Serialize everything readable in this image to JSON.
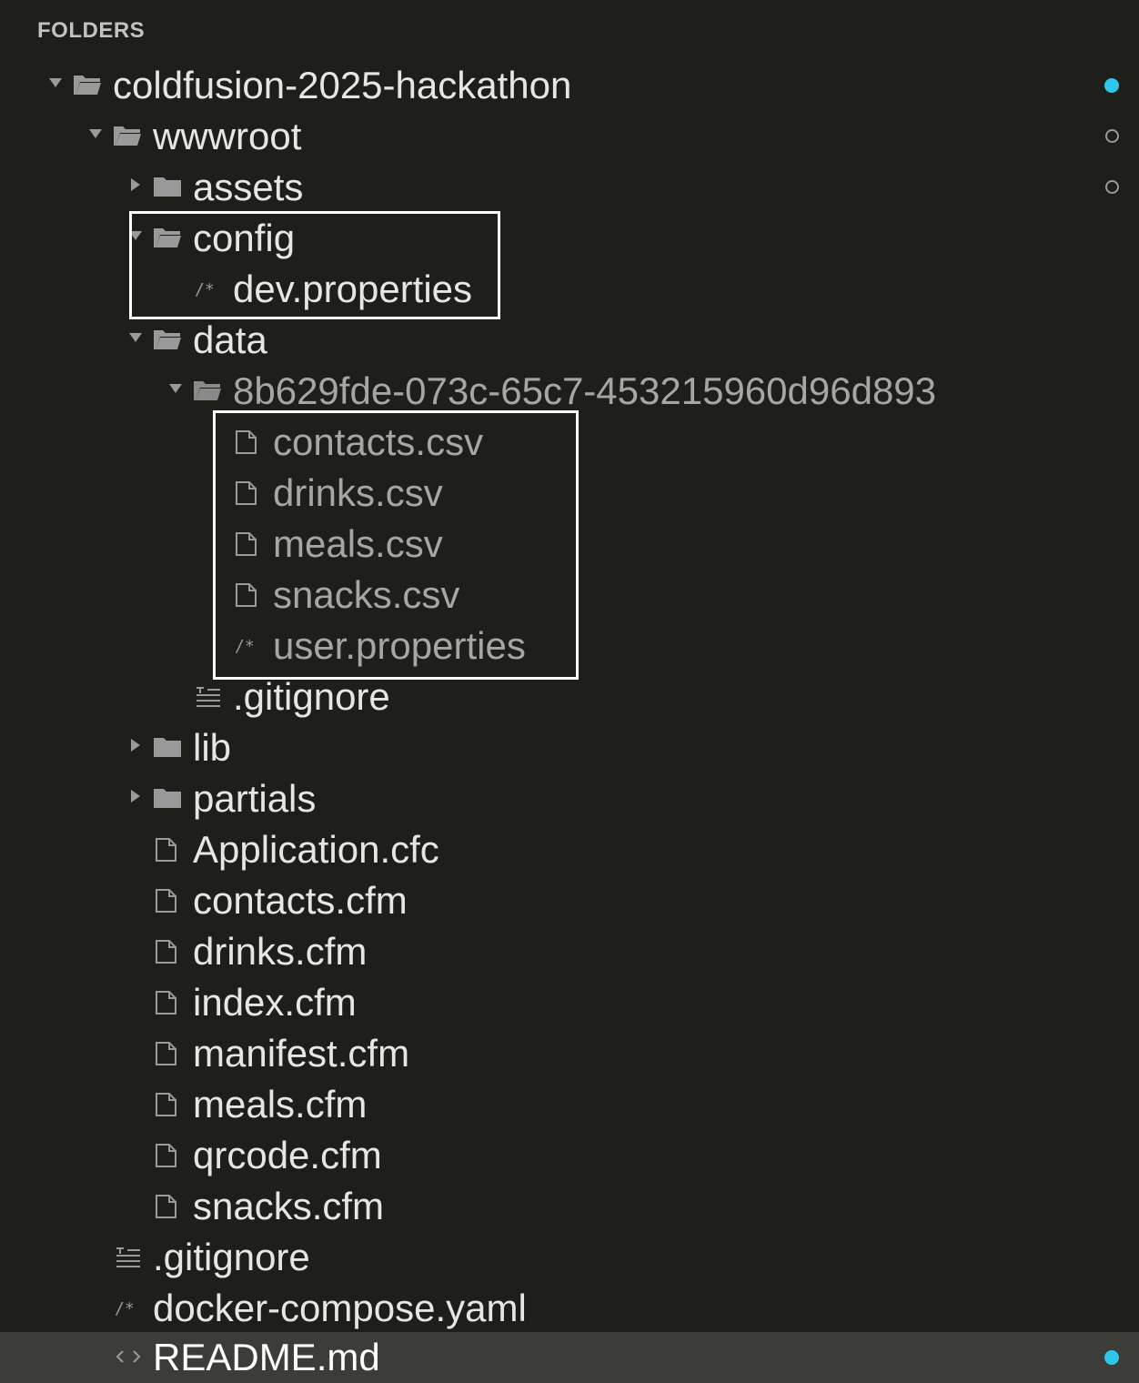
{
  "header": {
    "title": "FOLDERS"
  },
  "tree": {
    "root": "coldfusion-2025-hackathon",
    "wwwroot": "wwwroot",
    "assets": "assets",
    "config": "config",
    "dev_properties": "dev.properties",
    "data": "data",
    "session_folder": "8b629fde-073c-65c7-453215960d96d893",
    "contacts_csv": "contacts.csv",
    "drinks_csv": "drinks.csv",
    "meals_csv": "meals.csv",
    "snacks_csv": "snacks.csv",
    "user_properties": "user.properties",
    "data_gitignore": ".gitignore",
    "lib": "lib",
    "partials": "partials",
    "application_cfc": "Application.cfc",
    "contacts_cfm": "contacts.cfm",
    "drinks_cfm": "drinks.cfm",
    "index_cfm": "index.cfm",
    "manifest_cfm": "manifest.cfm",
    "meals_cfm": "meals.cfm",
    "qrcode_cfm": "qrcode.cfm",
    "snacks_cfm": "snacks.cfm",
    "root_gitignore": ".gitignore",
    "docker_compose": "docker-compose.yaml",
    "readme": "README.md"
  },
  "colors": {
    "background": "#1e1e1b",
    "selected_row": "#3c3c38",
    "modified_dot": "#2fc6ec",
    "text": "#e6e6e6",
    "dim_text": "#a6a6a6"
  },
  "icons": {
    "folder_open": "folder-open-icon",
    "folder_closed": "folder-icon",
    "file": "file-icon",
    "properties": "comment-file-icon",
    "gitignore": "text-file-icon",
    "markdown": "code-brackets-icon"
  }
}
